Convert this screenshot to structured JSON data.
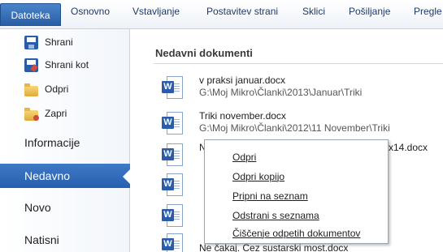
{
  "ribbon": {
    "tabs": [
      "Datoteka",
      "Osnovno",
      "Vstavljanje",
      "Postavitev strani",
      "Sklici",
      "Pošiljanje",
      "Pregle"
    ]
  },
  "nav": {
    "items": [
      {
        "label": "Shrani",
        "icon": "save-icon"
      },
      {
        "label": "Shrani kot",
        "icon": "save-as-icon"
      },
      {
        "label": "Odpri",
        "icon": "open-folder-icon"
      },
      {
        "label": "Zapri",
        "icon": "close-folder-icon"
      }
    ],
    "sections": [
      "Informacije",
      "Nedavno",
      "Novo",
      "Natisni"
    ],
    "active": "Nedavno"
  },
  "recent": {
    "title": "Nedavni dokumenti",
    "documents": [
      {
        "name": "v praksi januar.docx",
        "path": "G:\\Moj Mikro\\Članki\\2013\\Januar\\Triki"
      },
      {
        "name": "Triki november.docx",
        "path": "G:\\Moj Mikro\\Članki\\2012\\11 November\\Triki"
      },
      {
        "name": "N",
        "tail": "x14.docx",
        "path": ""
      },
      {
        "name": "",
        "path": ""
      },
      {
        "name": "",
        "path": ""
      },
      {
        "name": "",
        "path": ""
      },
      {
        "name": "Ne čakaj. Čez sustarski most.docx",
        "path": ""
      }
    ]
  },
  "context_menu": {
    "items": [
      "Odpri",
      "Odpri kopijo",
      "Pripni na seznam",
      "Odstrani s seznama",
      "Čiščenje odpetih dokumentov"
    ]
  },
  "colors": {
    "accent": "#2b5ca8",
    "active_nav": "#2f6bb8"
  }
}
